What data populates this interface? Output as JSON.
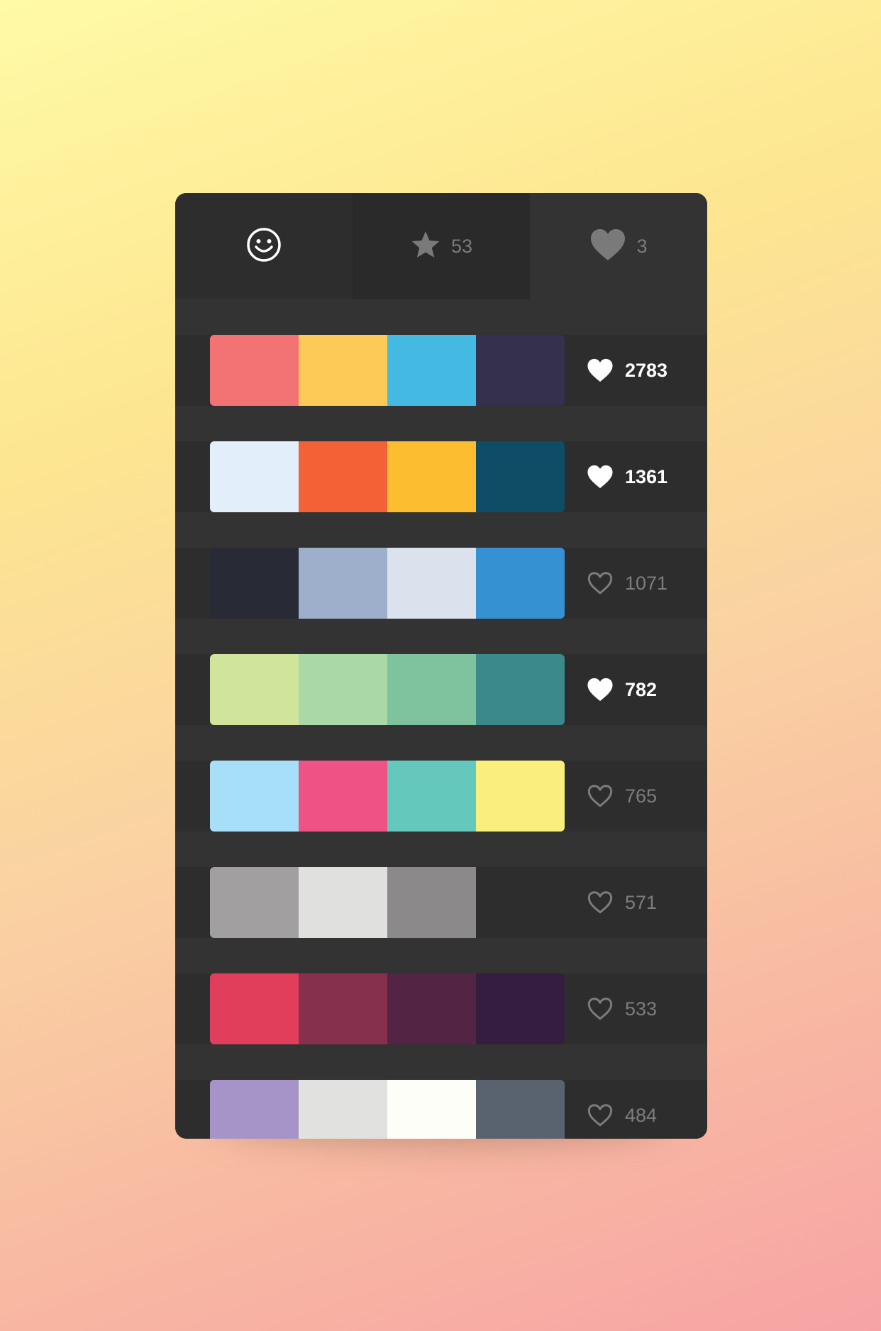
{
  "tabs": [
    {
      "name": "tab-smiley",
      "icon": "smiley-icon",
      "count": null,
      "active": true
    },
    {
      "name": "tab-starred",
      "icon": "star-icon",
      "count": "53",
      "active": false
    },
    {
      "name": "tab-liked",
      "icon": "heart-icon",
      "count": "3",
      "active": false
    }
  ],
  "palettes": [
    {
      "colors": [
        "#f37374",
        "#fdc957",
        "#44b9e2",
        "#34304d"
      ],
      "likes": "2783",
      "liked": true
    },
    {
      "colors": [
        "#e2eef9",
        "#f26236",
        "#fcbe30",
        "#0f4c65"
      ],
      "likes": "1361",
      "liked": true
    },
    {
      "colors": [
        "#282b36",
        "#9eafcc",
        "#dbe2ed",
        "#3691d2"
      ],
      "likes": "1071",
      "liked": false
    },
    {
      "colors": [
        "#d1e49c",
        "#aad9a7",
        "#7ec39e",
        "#3b898a"
      ],
      "likes": "782",
      "liked": true
    },
    {
      "colors": [
        "#a7dff9",
        "#ef5386",
        "#64c8bc",
        "#faee7d"
      ],
      "likes": "765",
      "liked": false
    },
    {
      "colors": [
        "#a29fa0",
        "#e0e0df",
        "#8c898a"
      ],
      "likes": "571",
      "liked": false
    },
    {
      "colors": [
        "#e03e5b",
        "#86304d",
        "#532443",
        "#341d3e"
      ],
      "likes": "533",
      "liked": false
    },
    {
      "colors": [
        "#a694c8",
        "#e1e1df",
        "#fefef9",
        "#596370"
      ],
      "likes": "484",
      "liked": false
    }
  ],
  "theme": {
    "card_bg": "#333333",
    "row_bg": "#2d2d2d",
    "liked_text": "#ffffff",
    "unliked_text": "#7d7d7d"
  }
}
